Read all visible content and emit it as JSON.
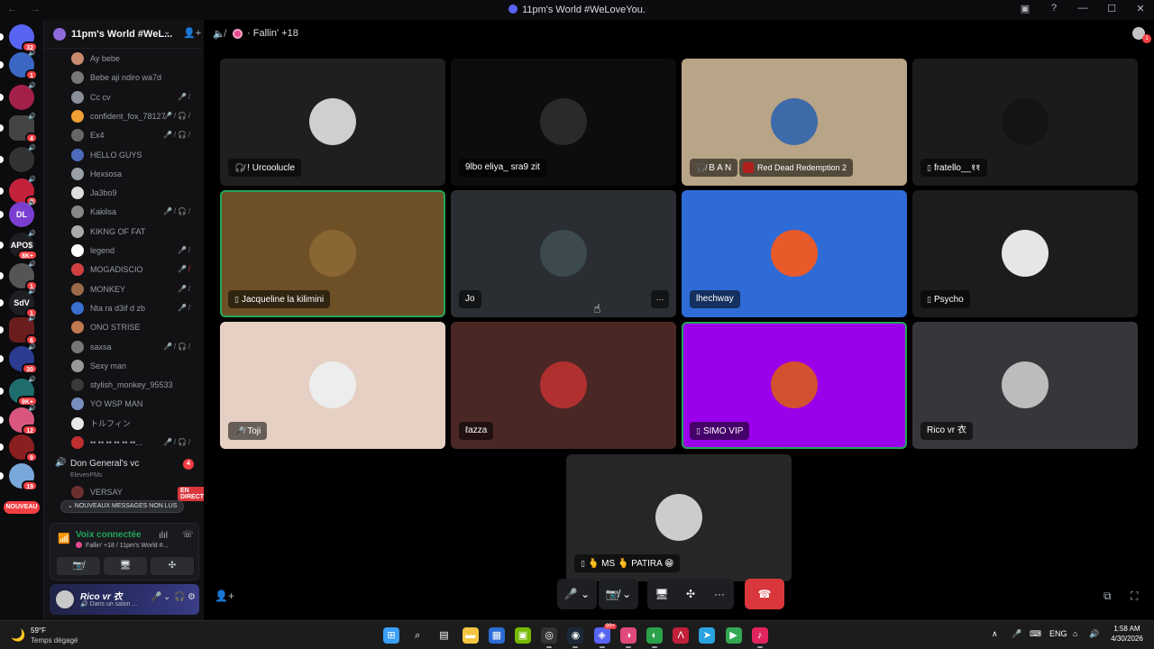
{
  "window": {
    "title": "11pm's World #WeLoveYou.",
    "nav": "←  →",
    "controls": [
      "▣",
      "?",
      "—",
      "☐",
      "✕"
    ]
  },
  "rail": {
    "servers": [
      {
        "badge": "32",
        "color": "#5865f2",
        "text": ""
      },
      {
        "badge": "1",
        "color": "#3b66c4",
        "text": ""
      },
      {
        "badge": "",
        "color": "#a32049",
        "text": ""
      },
      {
        "badge": "4",
        "color": "#444444",
        "text": ""
      },
      {
        "badge": "",
        "color": "#333333",
        "text": ""
      },
      {
        "badge": "8",
        "color": "#c4213a",
        "text": ""
      },
      {
        "badge": "",
        "color": "#7a3fd1",
        "text": "DL"
      },
      {
        "badge": "8K+",
        "color": "#1e1f22",
        "text": "APO$"
      },
      {
        "badge": "1",
        "color": "#555555",
        "text": ""
      },
      {
        "badge": "1",
        "color": "#1e1f22",
        "text": "SdV"
      },
      {
        "badge": "6",
        "color": "#6b1d1d",
        "text": ""
      },
      {
        "badge": "30",
        "color": "#2b3b8f",
        "text": ""
      },
      {
        "badge": "9K+",
        "color": "#1f6d6d",
        "text": ""
      },
      {
        "badge": "12",
        "color": "#d9577f",
        "text": ""
      },
      {
        "badge": "9",
        "color": "#8b1f1f",
        "text": ""
      },
      {
        "badge": "19",
        "color": "#7aa7d9",
        "text": ""
      }
    ],
    "new_label": "NOUVEAU"
  },
  "server": {
    "name": "11pm's World #WeL...",
    "chevron": "⌄",
    "invite": "👤+"
  },
  "members": [
    {
      "name": "Ay bebe",
      "color": "#c98a6e",
      "icons": ""
    },
    {
      "name": "Bebe aji ndiro wa7d",
      "color": "#777777",
      "icons": ""
    },
    {
      "name": "Cc cv",
      "color": "#8a8f99",
      "icons": "🎤̸"
    },
    {
      "name": "confident_fox_78127",
      "color": "#f0a030",
      "icons": "🎤̸🎧̸"
    },
    {
      "name": "Ex4",
      "color": "#666666",
      "icons": "🎤̸🎧̸"
    },
    {
      "name": "HELLO GUYS",
      "color": "#4d6bbd",
      "icons": ""
    },
    {
      "name": "Hexsosa",
      "color": "#9aa0a6",
      "icons": ""
    },
    {
      "name": "Ja3bo9",
      "color": "#dddddd",
      "icons": ""
    },
    {
      "name": "Kakilsa",
      "color": "#888888",
      "icons": "🎤̸🎧̸"
    },
    {
      "name": "KIKNG OF FAT",
      "color": "#aaaaaa",
      "icons": ""
    },
    {
      "name": "legend",
      "color": "#ffffff",
      "icons": "🎤̸"
    },
    {
      "name": "MOGADISCIO",
      "color": "#d04040",
      "icons": "🎤̸",
      "red": true
    },
    {
      "name": "MONKEY",
      "color": "#9a6a4a",
      "icons": "🎤̸"
    },
    {
      "name": "Nta ra d3if d zb",
      "color": "#3a6fd0",
      "icons": "🎤̸"
    },
    {
      "name": "ONO STRISE",
      "color": "#c07850",
      "icons": ""
    },
    {
      "name": "saxsa",
      "color": "#777777",
      "icons": "🎤̸🎧̸"
    },
    {
      "name": "Sexy man",
      "color": "#999999",
      "icons": ""
    },
    {
      "name": "stylish_monkey_95533",
      "color": "#3a3a3a",
      "icons": ""
    },
    {
      "name": "YO WSP MAN",
      "color": "#7a8fc0",
      "icons": ""
    },
    {
      "name": "トルフィン",
      "color": "#e8e8e8",
      "icons": ""
    },
    {
      "name": "•• •• •• •• •• ••...",
      "color": "#c03030",
      "icons": "🎤̸🎧̸"
    }
  ],
  "voice_channel_2": {
    "name": "Don General's vc",
    "sub": "ElevenPMs",
    "badge": "4"
  },
  "versay": {
    "name": "VERSAY",
    "live": "EN DIRECT"
  },
  "unread_pill": "⌄  NOUVEAUX MESSAGES NON LUS",
  "voice_panel": {
    "status": "Voix connectée",
    "channel": "Fallin' +18 / 11pm's World #...",
    "wave": "ılıl",
    "hang": "☏",
    "buttons": [
      "📷̸",
      "🖥",
      "✣"
    ]
  },
  "user_panel": {
    "name": "Rico vr 衣",
    "status": "🔊 Dans un salon ...",
    "mic": "🎤",
    "chev1": "⌄",
    "headset": "🎧",
    "chev2": "⌄",
    "settings": "⚙"
  },
  "call": {
    "speaker_icon": "🔈̸",
    "channel": "Fallin' +18",
    "tiles": [
      {
        "name": "! Urcoolucle",
        "pre": "🎧̸",
        "bg": "#1f1f1f",
        "avatar": "#cfcfcf"
      },
      {
        "name": "9lbo eliya_ sra9 zit",
        "pre": "",
        "bg": "#0d0d0d",
        "avatar": "#2a2a2a"
      },
      {
        "name": "B A N",
        "pre": "🎧̸",
        "bg": "#b8a486",
        "avatar": "#3d6aa8",
        "game": "Red Dead Redemption 2"
      },
      {
        "name": "fratello__११",
        "pre": "▯",
        "bg": "#1b1b1b",
        "avatar": "#141414"
      },
      {
        "name": "Jacqueline la kilimini",
        "pre": "▯",
        "bg": "#6e5026",
        "avatar": "#8a6635",
        "speaking": true
      },
      {
        "name": "Jo",
        "pre": "",
        "bg": "#2a2d31",
        "avatar": "#3c4a50",
        "more": "···"
      },
      {
        "name": "lhechway",
        "pre": "",
        "bg": "#2e6bd6",
        "avatar": "#e85a2a"
      },
      {
        "name": "Psycho",
        "pre": "▯",
        "bg": "#1c1c1c",
        "avatar": "#e6e6e6"
      },
      {
        "name": "Toji",
        "pre": "🎤̸",
        "bg": "#e5d0c3",
        "avatar": "#ededed"
      },
      {
        "name": "ℓazza",
        "pre": "",
        "bg": "#4a2724",
        "avatar": "#b03030"
      },
      {
        "name": "SIMO VIP",
        "pre": "▯",
        "bg": "#9b00ea",
        "avatar": "#d4512f",
        "speaking": true
      },
      {
        "name": "Rico vr 衣",
        "pre": "",
        "bg": "#37373b",
        "avatar": "#bcbcbc"
      },
      {
        "name": "🫰 MS 🫰 PATIRA 😁",
        "pre": "▯",
        "bg": "#262626",
        "avatar": "#cccccc"
      }
    ]
  },
  "controls": {
    "mic": "🎤",
    "mic_chev": "⌄",
    "cam": "📷̸",
    "cam_chev": "⌄",
    "share": "🖥",
    "activity": "✣",
    "more": "···",
    "hangup": "☎",
    "add": "👤+",
    "popout": "⧉",
    "fullscreen": "⛶"
  },
  "taskbar": {
    "weather_temp": "59°F",
    "weather_desc": "Temps dégagé",
    "weather_icon": "🌙",
    "apps": [
      "⊞",
      "⌕",
      "▤",
      "▬",
      "▦",
      "▣",
      "◎",
      "◉",
      "◈",
      "◑",
      "◐",
      "Λ",
      "➤",
      "▶",
      "♪"
    ],
    "app_badges": {
      "discord": "99+"
    },
    "tray": [
      "∧",
      "🎤",
      "⌨",
      "ENG",
      "⌂",
      "🔊",
      "▮"
    ],
    "time": "1:58 AM",
    "date": "4/30/2026"
  }
}
